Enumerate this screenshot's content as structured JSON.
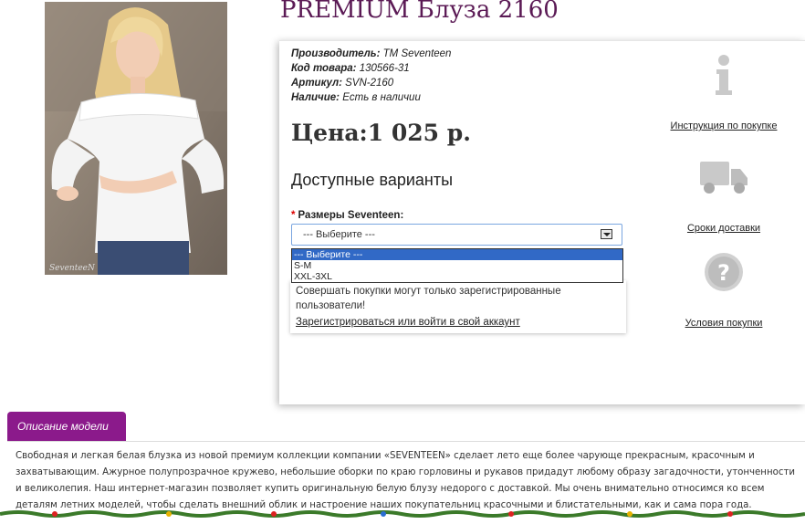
{
  "product": {
    "title": "PREMIUM Блуза 2160",
    "specs": [
      {
        "label": "Производитель:",
        "value": "TM Seventeen"
      },
      {
        "label": "Код товара:",
        "value": "130566-31"
      },
      {
        "label": "Артикул:",
        "value": "SVN-2160"
      },
      {
        "label": "Наличие:",
        "value": "Есть в наличии"
      }
    ],
    "price": "Цена:1 025 р.",
    "variants_title": "Доступные варианты",
    "size_label": "Размеры Seventeen:",
    "required_mark": "*",
    "select_value": "--- Выберите ---",
    "options": [
      "--- Выберите ---",
      "S-M",
      "XXL-3XL"
    ],
    "notice_text": "Совершать покупки могут только зарегистрированные пользователи!",
    "notice_link": "Зарегистрироваться или войти в свой аккаунт",
    "photo_watermark": "SeventeeN"
  },
  "side_links": [
    {
      "icon": "info-icon",
      "label": "Инструкция по покупке"
    },
    {
      "icon": "truck-icon",
      "label": "Сроки доставки"
    },
    {
      "icon": "question-icon",
      "label": "Условия покупки"
    }
  ],
  "tab": {
    "label": "Описание модели"
  },
  "description": "Свободная и легкая белая блузка из новой премиум коллекции компании «SEVENTEEN» сделает лето еще более чарующе прекрасным, красочным и захватывающим. Ажурное полупрозрачное кружево, небольшие оборки по краю горловины и рукавов придадут любому образу загадочности, утонченности и великолепия. Наш интернет-магазин позволяет купить оригинальную белую блузу недорого с доставкой. Мы очень внимательно относимся ко всем деталям летних моделей, чтобы сделать внешний облик и настроение наших покупательниц красочными и блистательными, как и сама пора года.",
  "colors": {
    "title": "#5b1a55",
    "tab": "#8b1a8b",
    "select_highlight": "#3169c6"
  }
}
